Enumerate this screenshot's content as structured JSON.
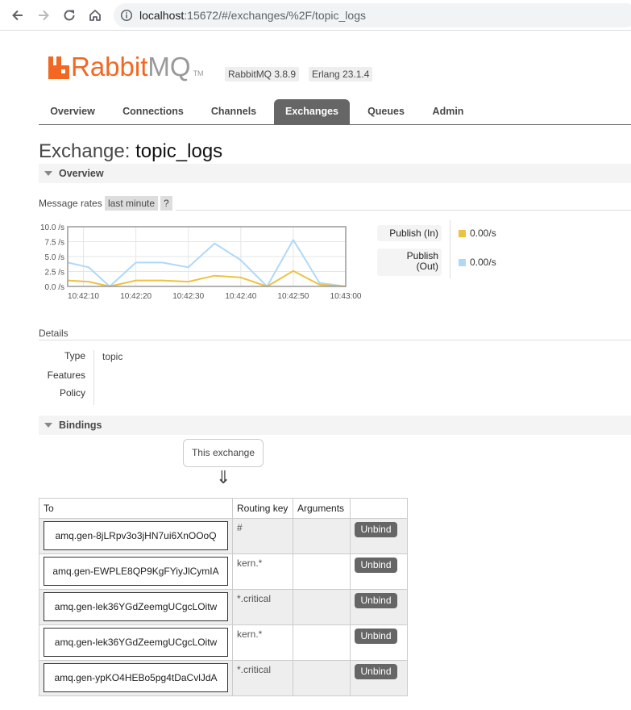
{
  "browser": {
    "url_host": "localhost",
    "url_rest": ":15672/#/exchanges/%2F/topic_logs"
  },
  "header": {
    "logo_brand": "Rabbit",
    "logo_mq": "MQ",
    "logo_tm": "TM",
    "version_rabbitmq": "RabbitMQ 3.8.9",
    "version_erlang": "Erlang 23.1.4"
  },
  "tabs": [
    {
      "label": "Overview"
    },
    {
      "label": "Connections"
    },
    {
      "label": "Channels"
    },
    {
      "label": "Exchanges",
      "active": true
    },
    {
      "label": "Queues"
    },
    {
      "label": "Admin"
    }
  ],
  "page": {
    "title_prefix": "Exchange:",
    "title_name": "topic_logs"
  },
  "overview": {
    "section_label": "Overview",
    "rates_label": "Message rates",
    "rates_period": "last minute",
    "help_label": "?",
    "legend": [
      {
        "label": "Publish (In)",
        "value": "0.00/s",
        "color": "#edc240"
      },
      {
        "label": "Publish (Out)",
        "value": "0.00/s",
        "color": "#afd8f8"
      }
    ]
  },
  "chart_data": {
    "type": "line",
    "x": [
      "10:42:07",
      "10:42:11",
      "10:42:15",
      "10:42:20",
      "10:42:25",
      "10:42:30",
      "10:42:35",
      "10:42:40",
      "10:42:45",
      "10:42:50",
      "10:42:55",
      "10:43:00"
    ],
    "x_ticks": [
      "10:42:10",
      "10:42:20",
      "10:42:30",
      "10:42:40",
      "10:42:50",
      "10:43:00"
    ],
    "y_ticks": [
      "10.0 /s",
      "7.5 /s",
      "5.0 /s",
      "2.5 /s",
      "0.0 /s"
    ],
    "ylim": [
      0,
      10
    ],
    "series": [
      {
        "name": "Publish (In)",
        "color": "#edc240",
        "values": [
          1.0,
          0.8,
          0.0,
          1.0,
          1.0,
          0.8,
          1.8,
          1.5,
          0.0,
          2.6,
          0.3,
          0.0
        ]
      },
      {
        "name": "Publish (Out)",
        "color": "#afd8f8",
        "values": [
          4.0,
          3.2,
          0.0,
          4.0,
          4.0,
          3.2,
          7.2,
          4.4,
          0.0,
          7.8,
          0.6,
          0.0
        ]
      }
    ],
    "grid": true
  },
  "details": {
    "label": "Details",
    "rows": [
      {
        "key": "Type",
        "value": "topic"
      },
      {
        "key": "Features",
        "value": ""
      },
      {
        "key": "Policy",
        "value": ""
      }
    ]
  },
  "bindings": {
    "section_label": "Bindings",
    "this_exchange": "This exchange",
    "arrow": "⇓",
    "columns": [
      "To",
      "Routing key",
      "Arguments",
      ""
    ],
    "unbind_label": "Unbind",
    "rows": [
      {
        "to": "amq.gen-8jLRpv3o3jHN7ui6XnOOoQ",
        "routing_key": "#",
        "arguments": ""
      },
      {
        "to": "amq.gen-EWPLE8QP9KgFYiyJlCymIA",
        "routing_key": "kern.*",
        "arguments": ""
      },
      {
        "to": "amq.gen-lek36YGdZeemgUCgcLOitw",
        "routing_key": "*.critical",
        "arguments": ""
      },
      {
        "to": "amq.gen-lek36YGdZeemgUCgcLOitw",
        "routing_key": "kern.*",
        "arguments": ""
      },
      {
        "to": "amq.gen-ypKO4HEBo5pg4tDaCvlJdA",
        "routing_key": "*.critical",
        "arguments": ""
      }
    ]
  }
}
